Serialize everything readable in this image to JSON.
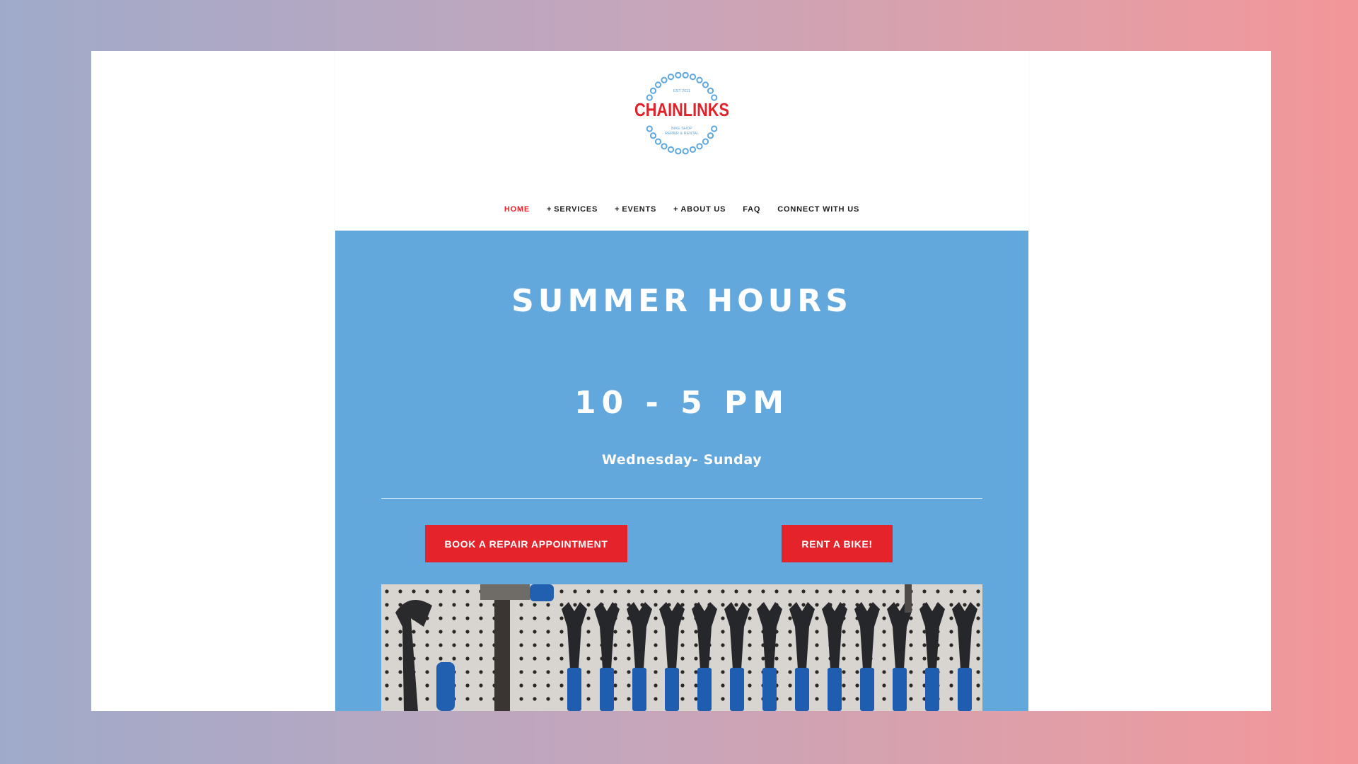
{
  "logo": {
    "name": "CHAINLINKS",
    "est": "EST 2011",
    "tagline_1": "BIKE SHOP",
    "tagline_2": "REPAIR & RENTAL"
  },
  "nav": {
    "items": [
      {
        "label": "HOME",
        "has_plus": false,
        "active": true
      },
      {
        "label": "SERVICES",
        "has_plus": true,
        "active": false
      },
      {
        "label": "EVENTS",
        "has_plus": true,
        "active": false
      },
      {
        "label": "ABOUT US",
        "has_plus": true,
        "active": false
      },
      {
        "label": "FAQ",
        "has_plus": false,
        "active": false
      },
      {
        "label": "CONNECT WITH US",
        "has_plus": false,
        "active": false
      }
    ],
    "plus_glyph": "+"
  },
  "hero": {
    "title": "SUMMER HOURS",
    "hours": "10 - 5 PM",
    "days": "Wednesday- Sunday",
    "repair_button": "BOOK A REPAIR APPOINTMENT",
    "rent_button": "RENT A BIKE!",
    "photo_icon": "pegboard-wrenches-photo"
  },
  "colors": {
    "accent_red": "#e5232b",
    "hero_blue": "#63a8dd",
    "logo_blue": "#5fa8e0",
    "logo_red": "#e0232a"
  }
}
